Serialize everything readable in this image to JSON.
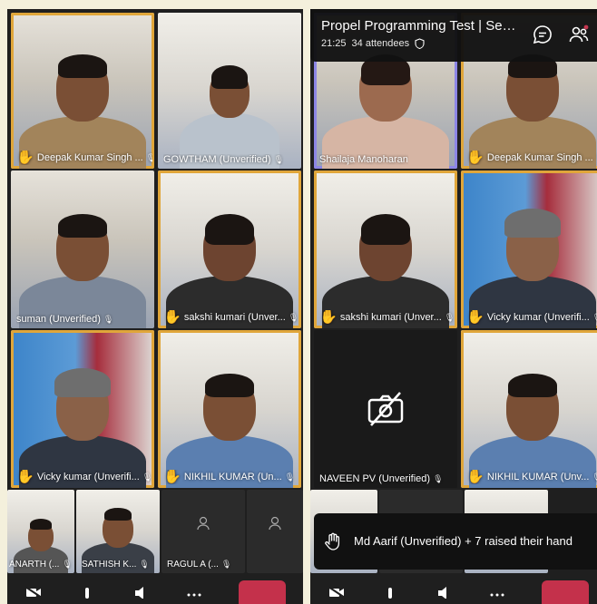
{
  "colors": {
    "raised_border": "#e0a63a",
    "active_speaker_border": "#8c86e6",
    "leave_button": "#c4314b",
    "tile_background": "#1f1f1f"
  },
  "left": {
    "tiles": [
      {
        "name": "Deepak Kumar Singh ...",
        "hand_raised": true
      },
      {
        "name": "GOWTHAM  (Unverified)",
        "hand_raised": false
      },
      {
        "name": "suman (Unverified)",
        "hand_raised": false
      },
      {
        "name": "sakshi kumari (Unver...",
        "hand_raised": true
      },
      {
        "name": "Vicky kumar (Unverifi...",
        "hand_raised": true
      },
      {
        "name": "NIKHIL KUMAR (Un...",
        "hand_raised": true
      },
      {
        "name": "ANARTH (...",
        "hand_raised": false
      },
      {
        "name": "SATHISH K...",
        "hand_raised": false
      },
      {
        "name": "RAGUL A (...",
        "hand_raised": false
      }
    ]
  },
  "right": {
    "header": {
      "title": "Propel Programming Test | Sen...",
      "time": "21:25",
      "attendees": "34 attendees"
    },
    "tiles": [
      {
        "name": "Shailaja Manoharan",
        "hand_raised": false
      },
      {
        "name": "Deepak Kumar Singh ...",
        "hand_raised": true
      },
      {
        "name": "sakshi kumari (Unver...",
        "hand_raised": true
      },
      {
        "name": "Vicky kumar (Unverifi...",
        "hand_raised": true
      },
      {
        "name": "NAVEEN PV (Unverified)",
        "hand_raised": false
      },
      {
        "name": "NIKHIL KUMAR (Unv...",
        "hand_raised": true
      }
    ],
    "toast": {
      "text": "Md Aarif (Unverified) + 7 raised their hand"
    }
  },
  "icons": {
    "hand": "✋",
    "mic": "🎙",
    "chat": "chat-icon",
    "participants": "people-icon",
    "camera_off": "camera-off-icon"
  }
}
